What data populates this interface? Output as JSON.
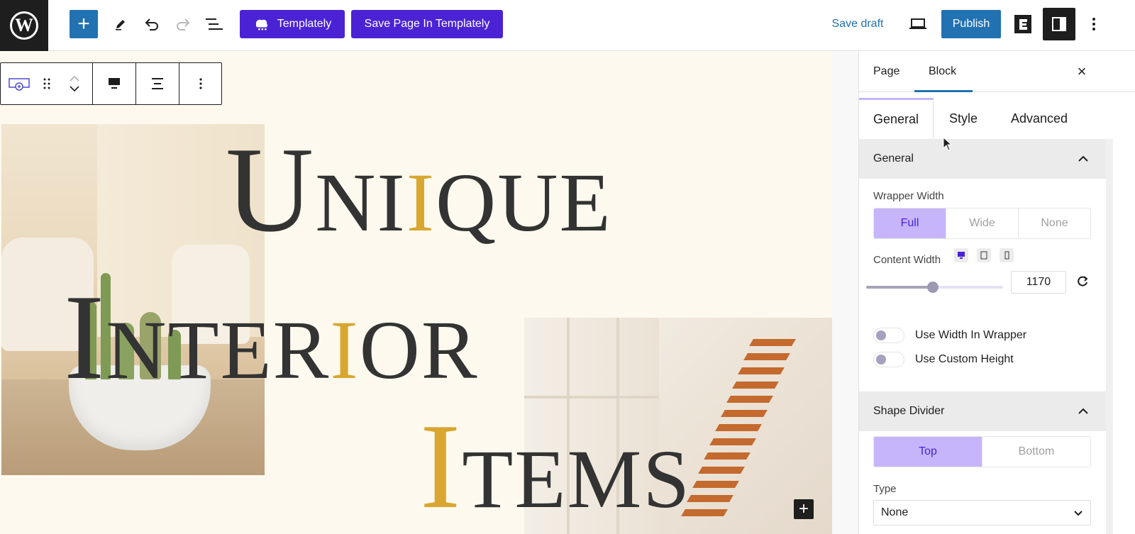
{
  "topbar": {
    "logo_letter": "W",
    "add_label": "+",
    "templately_label": "Templately",
    "save_template_label": "Save Page In Templately",
    "save_draft_label": "Save draft",
    "publish_label": "Publish",
    "accent_color": "#2271b1",
    "templately_color": "#4b23d4"
  },
  "canvas": {
    "headline": {
      "line1": {
        "first": "U",
        "rest_a": "NI",
        "accent": "I",
        "rest_b": "QUE"
      },
      "line2": {
        "first": "I",
        "rest_a": "NTER",
        "accent": "I",
        "rest_b": "OR"
      },
      "line3": {
        "accent": "I",
        "rest": "TEMS"
      }
    },
    "accent_color": "#d9a72f",
    "inserter_label": "+"
  },
  "panel": {
    "tabs": {
      "page": "Page",
      "block": "Block"
    },
    "close_label": "×",
    "subtabs": {
      "general": "General",
      "style": "Style",
      "advanced": "Advanced"
    },
    "general_section": {
      "title": "General",
      "wrapper_width_label": "Wrapper Width",
      "wrapper_options": [
        "Full",
        "Wide",
        "None"
      ],
      "wrapper_selected": "Full",
      "content_width_label": "Content Width",
      "content_width_value": "1170",
      "content_width_slider_fraction": 0.46,
      "toggles": [
        {
          "label": "Use Width In Wrapper",
          "on": false
        },
        {
          "label": "Use Custom Height",
          "on": false
        }
      ]
    },
    "shape_section": {
      "title": "Shape Divider",
      "position_options": [
        "Top",
        "Bottom"
      ],
      "position_selected": "Top",
      "type_label": "Type",
      "type_value": "None"
    }
  }
}
